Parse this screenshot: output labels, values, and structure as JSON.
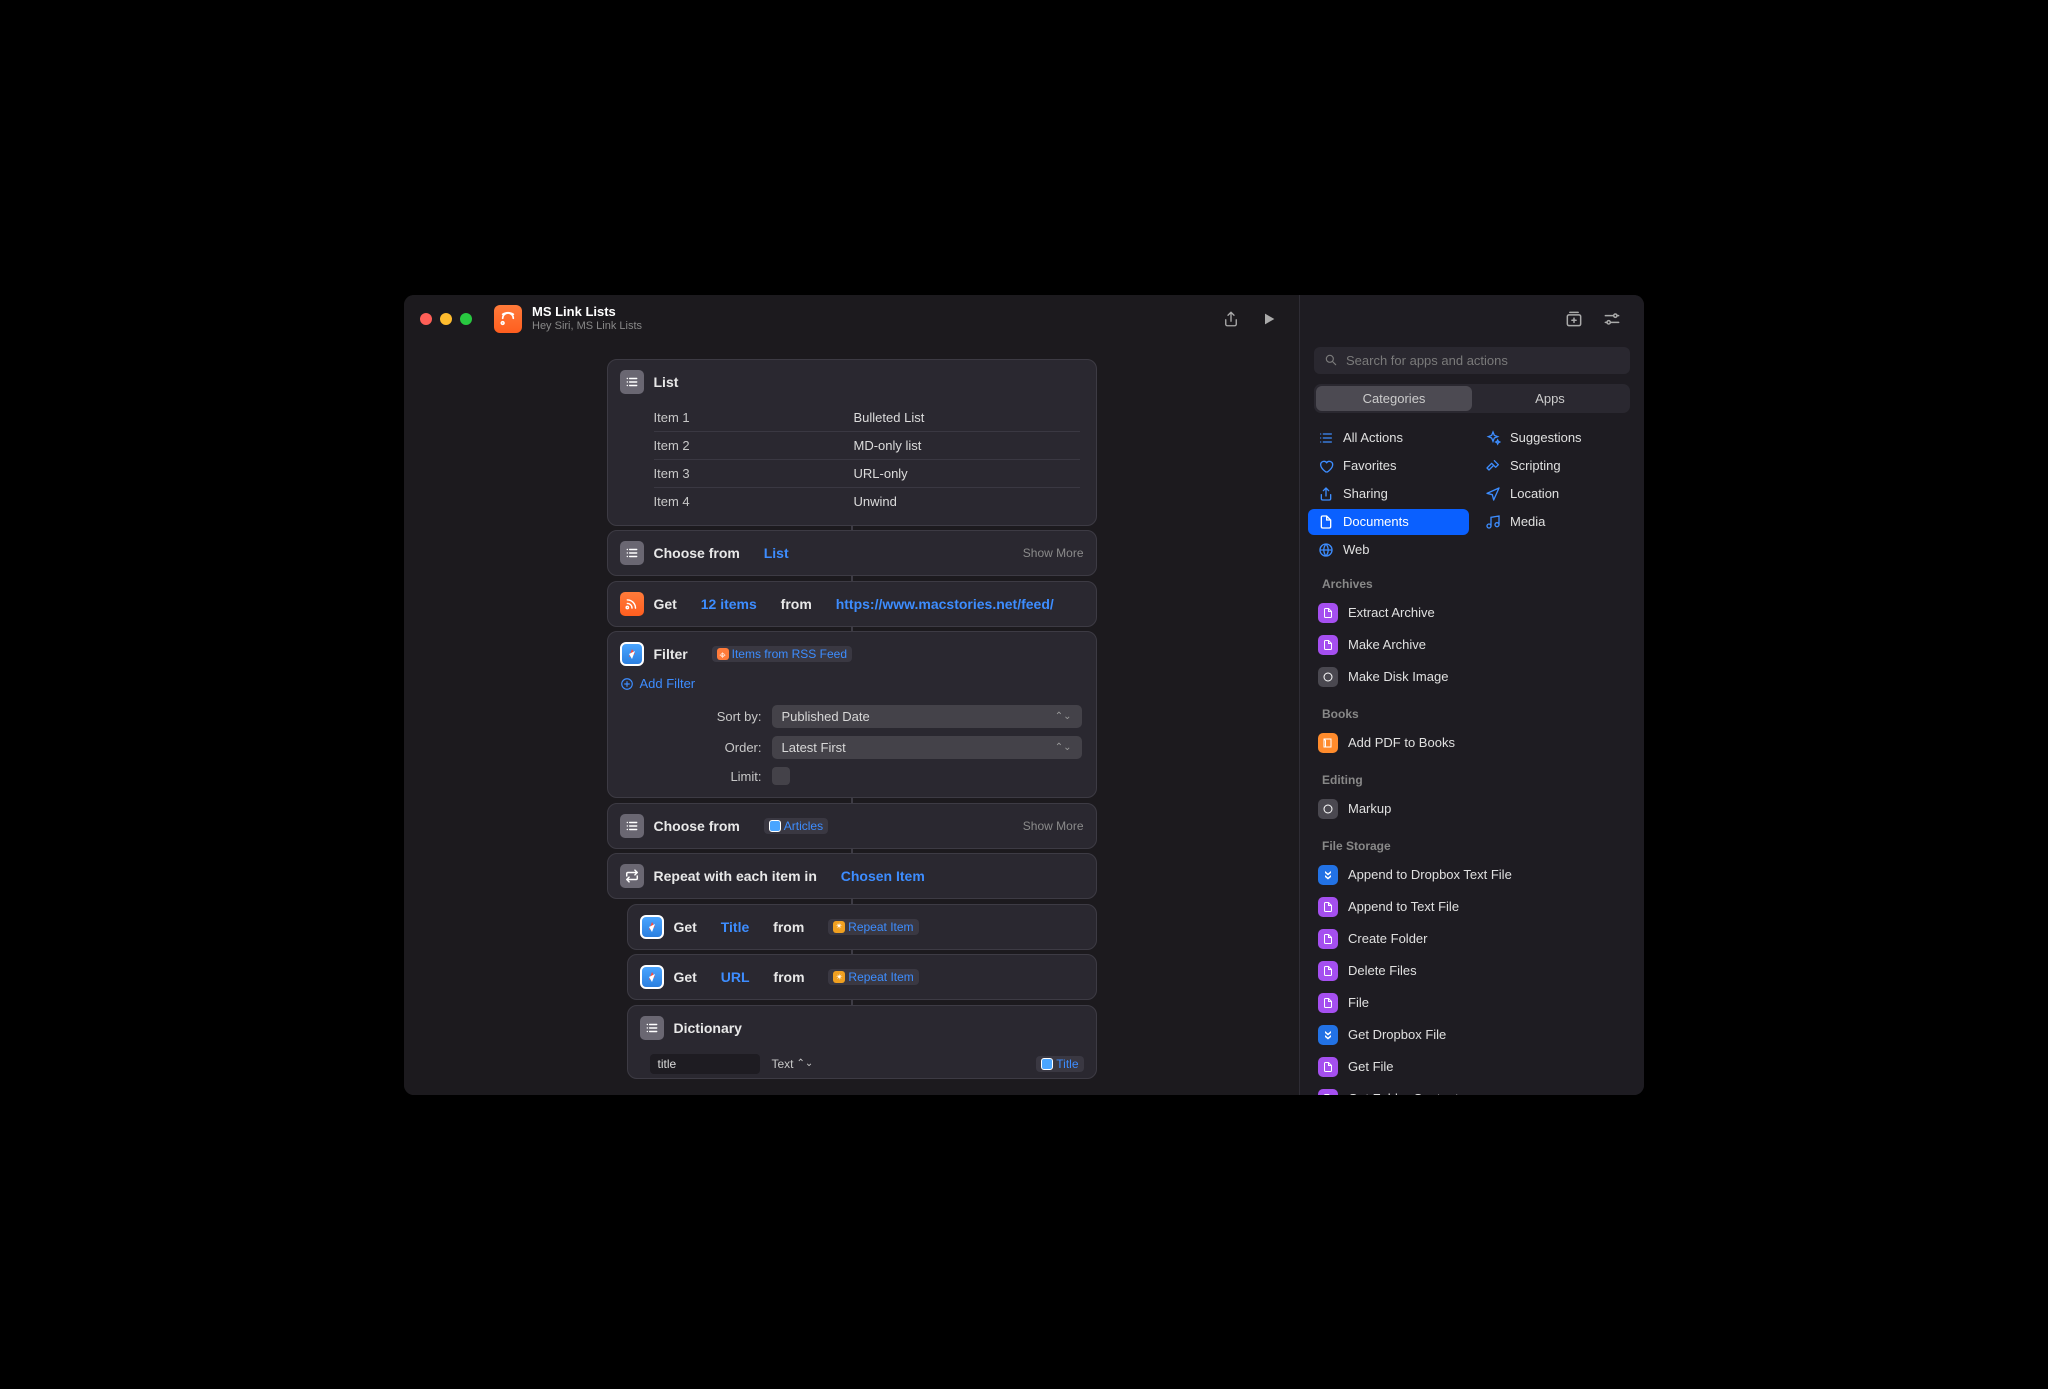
{
  "titlebar": {
    "title": "MS Link Lists",
    "subtitle": "Hey Siri, MS Link Lists"
  },
  "actions": {
    "list": {
      "label": "List",
      "rows": [
        {
          "key": "Item 1",
          "val": "Bulleted List"
        },
        {
          "key": "Item 2",
          "val": "MD-only list"
        },
        {
          "key": "Item 3",
          "val": "URL-only"
        },
        {
          "key": "Item 4",
          "val": "Unwind"
        }
      ]
    },
    "choose1": {
      "prefix": "Choose from",
      "token": "List",
      "showMore": "Show More"
    },
    "rss": {
      "get": "Get",
      "count": "12 items",
      "from": "from",
      "url": "https://www.macstories.net/feed/"
    },
    "filter": {
      "label": "Filter",
      "chip": "Items from RSS Feed",
      "addFilter": "Add Filter",
      "sortByLabel": "Sort by:",
      "sortByValue": "Published Date",
      "orderLabel": "Order:",
      "orderValue": "Latest First",
      "limitLabel": "Limit:"
    },
    "choose2": {
      "prefix": "Choose from",
      "chip": "Articles",
      "showMore": "Show More"
    },
    "repeat": {
      "prefix": "Repeat with each item in",
      "token": "Chosen Item"
    },
    "getTitle": {
      "get": "Get",
      "prop": "Title",
      "from": "from",
      "chip": "Repeat Item"
    },
    "getURL": {
      "get": "Get",
      "prop": "URL",
      "from": "from",
      "chip": "Repeat Item"
    },
    "dict": {
      "label": "Dictionary",
      "row1": {
        "key": "title",
        "type": "Text",
        "chip": "Title"
      }
    }
  },
  "sidebar": {
    "searchPlaceholder": "Search for apps and actions",
    "segCategories": "Categories",
    "segApps": "Apps",
    "categories": [
      {
        "icon": "list",
        "label": "All Actions"
      },
      {
        "icon": "sparkle",
        "label": "Suggestions"
      },
      {
        "icon": "heart",
        "label": "Favorites"
      },
      {
        "icon": "hammer",
        "label": "Scripting"
      },
      {
        "icon": "share",
        "label": "Sharing"
      },
      {
        "icon": "location",
        "label": "Location"
      },
      {
        "icon": "doc",
        "label": "Documents",
        "selected": true
      },
      {
        "icon": "music",
        "label": "Media"
      },
      {
        "icon": "web",
        "label": "Web"
      }
    ],
    "sections": [
      {
        "title": "Archives",
        "items": [
          {
            "icon": "purple",
            "label": "Extract Archive"
          },
          {
            "icon": "purple",
            "label": "Make Archive"
          },
          {
            "icon": "gray",
            "label": "Make Disk Image"
          }
        ]
      },
      {
        "title": "Books",
        "items": [
          {
            "icon": "orange",
            "label": "Add PDF to Books"
          }
        ]
      },
      {
        "title": "Editing",
        "items": [
          {
            "icon": "gray",
            "label": "Markup"
          }
        ]
      },
      {
        "title": "File Storage",
        "items": [
          {
            "icon": "blue",
            "label": "Append to Dropbox Text File"
          },
          {
            "icon": "purple",
            "label": "Append to Text File"
          },
          {
            "icon": "purple",
            "label": "Create Folder"
          },
          {
            "icon": "purple",
            "label": "Delete Files"
          },
          {
            "icon": "purple",
            "label": "File"
          },
          {
            "icon": "blue",
            "label": "Get Dropbox File"
          },
          {
            "icon": "purple",
            "label": "Get File"
          },
          {
            "icon": "purple",
            "label": "Get Folder Contents"
          }
        ]
      }
    ]
  }
}
